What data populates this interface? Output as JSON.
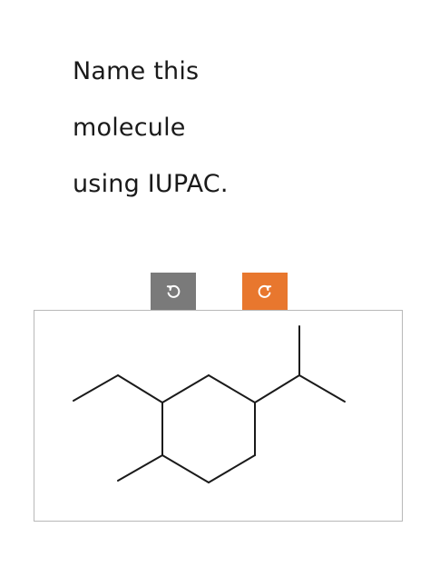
{
  "question": {
    "lines": [
      "Name this",
      "molecule",
      "using IUPAC."
    ]
  },
  "toolbar": {
    "undo_icon": "undo-icon",
    "redo_icon": "redo-icon",
    "undo_color": "#7a7a7a",
    "redo_color": "#e8772e"
  },
  "structure": {
    "description_icon": "skeletal-structure"
  }
}
